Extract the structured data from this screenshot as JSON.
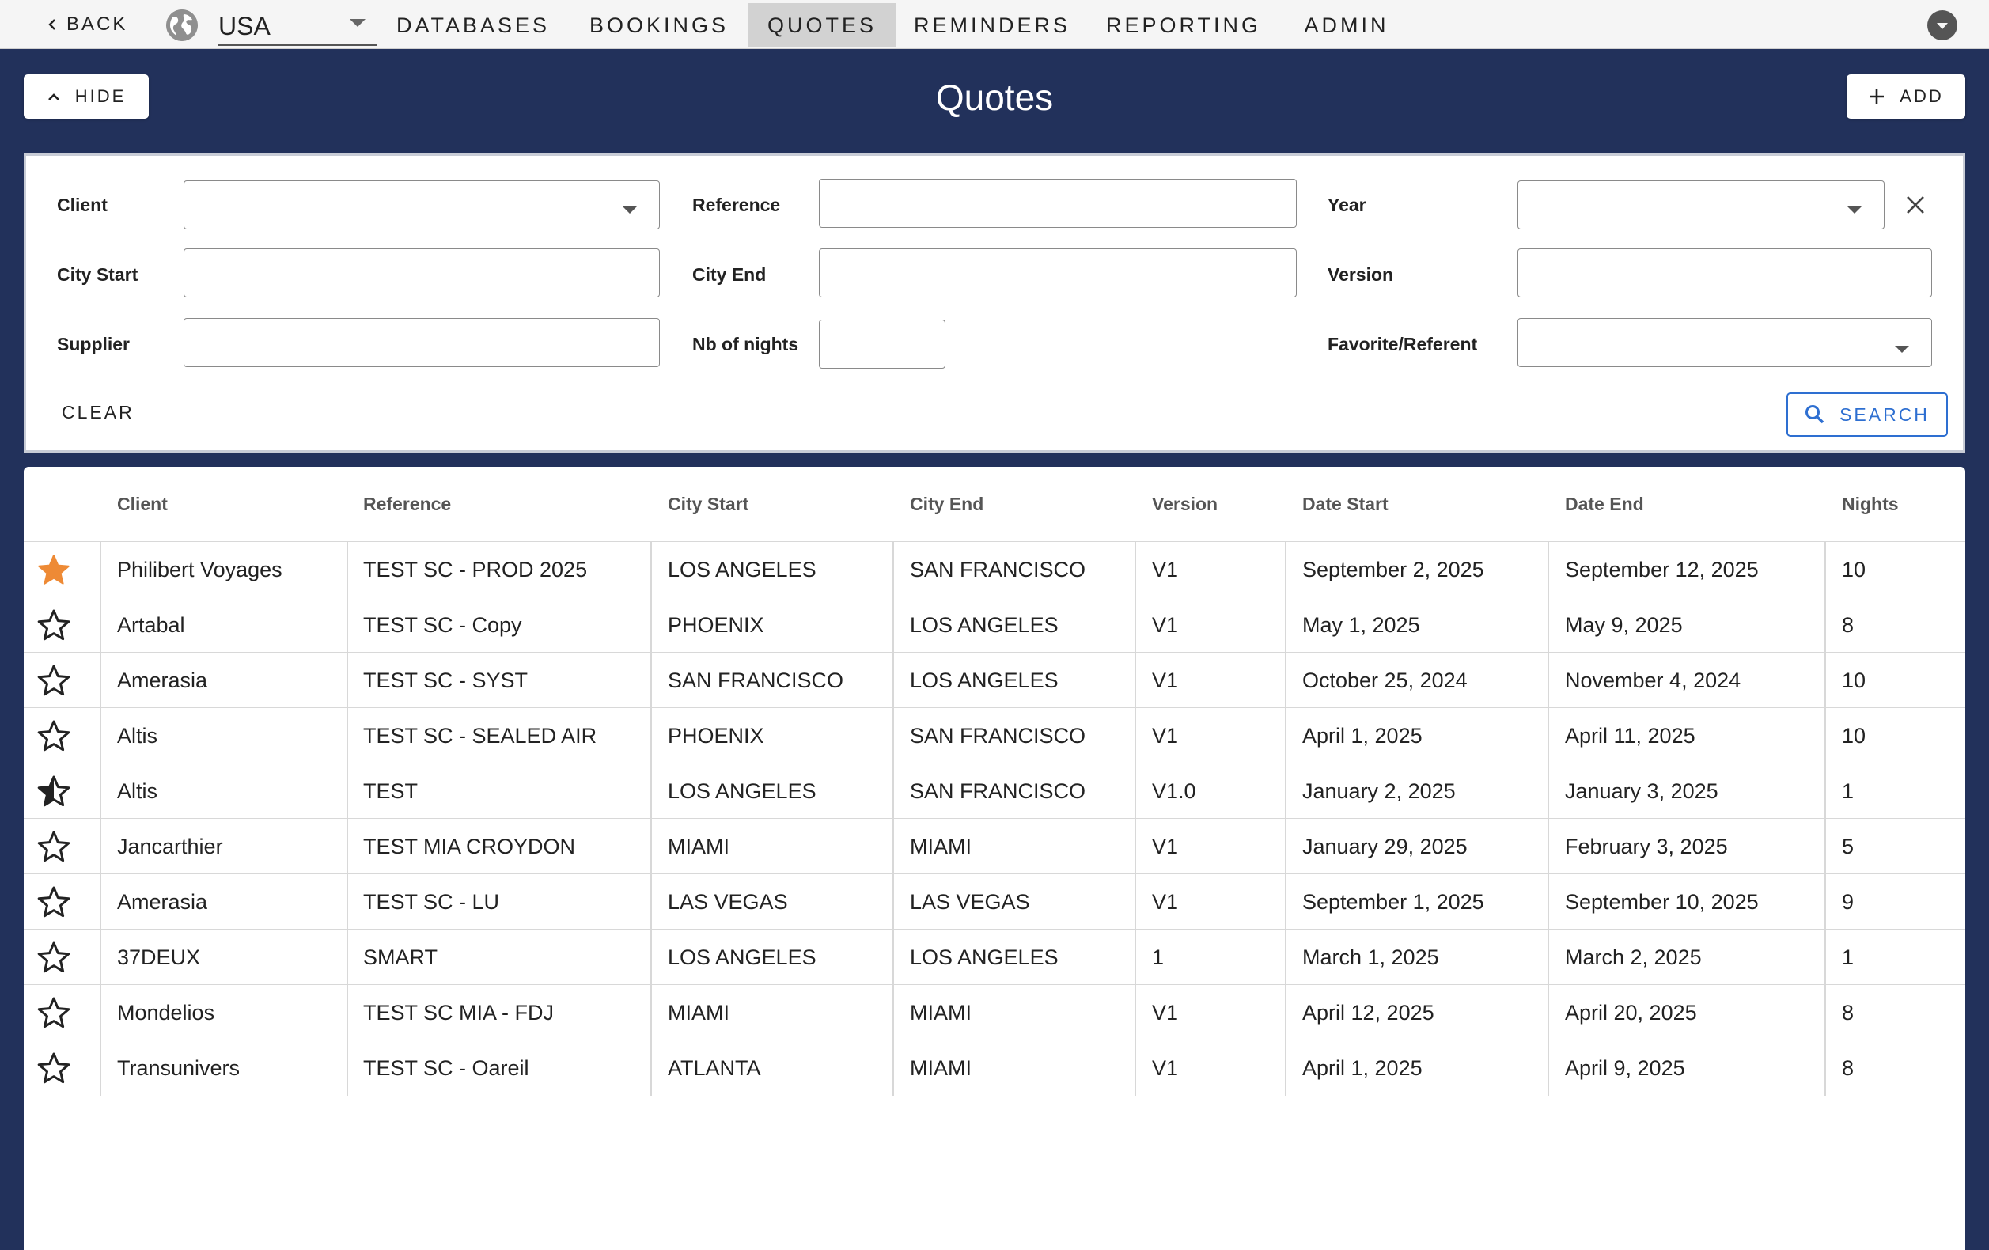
{
  "topbar": {
    "back_label": "BACK",
    "country": "USA",
    "tabs": [
      {
        "label": "DATABASES"
      },
      {
        "label": "BOOKINGS"
      },
      {
        "label": "QUOTES"
      },
      {
        "label": "REMINDERS"
      },
      {
        "label": "REPORTING"
      },
      {
        "label": "ADMIN"
      }
    ],
    "active_tab": "QUOTES"
  },
  "header": {
    "hide_label": "HIDE",
    "title": "Quotes",
    "add_label": "ADD"
  },
  "filters": {
    "client_label": "Client",
    "reference_label": "Reference",
    "year_label": "Year",
    "city_start_label": "City Start",
    "city_end_label": "City End",
    "version_label": "Version",
    "supplier_label": "Supplier",
    "nights_label": "Nb of nights",
    "favorite_label": "Favorite/Referent",
    "clear_label": "CLEAR",
    "search_label": "SEARCH"
  },
  "table": {
    "headers": [
      "Client",
      "Reference",
      "City Start",
      "City End",
      "Version",
      "Date Start",
      "Date End",
      "Nights"
    ],
    "rows": [
      {
        "star": "filled-orange",
        "client": "Philibert Voyages",
        "reference": "TEST SC - PROD 2025",
        "city_start": "LOS ANGELES",
        "city_end": "SAN FRANCISCO",
        "version": "V1",
        "date_start": "September 2, 2025",
        "date_end": "September 12, 2025",
        "nights": "10"
      },
      {
        "star": "outline",
        "client": "Artabal",
        "reference": "TEST SC - Copy",
        "city_start": "PHOENIX",
        "city_end": "LOS ANGELES",
        "version": "V1",
        "date_start": "May 1, 2025",
        "date_end": "May 9, 2025",
        "nights": "8"
      },
      {
        "star": "outline",
        "client": "Amerasia",
        "reference": "TEST SC - SYST",
        "city_start": "SAN FRANCISCO",
        "city_end": "LOS ANGELES",
        "version": "V1",
        "date_start": "October 25, 2024",
        "date_end": "November 4, 2024",
        "nights": "10"
      },
      {
        "star": "outline",
        "client": "Altis",
        "reference": "TEST SC - SEALED AIR",
        "city_start": "PHOENIX",
        "city_end": "SAN FRANCISCO",
        "version": "V1",
        "date_start": "April 1, 2025",
        "date_end": "April 11, 2025",
        "nights": "10"
      },
      {
        "star": "half",
        "client": "Altis",
        "reference": "TEST",
        "city_start": "LOS ANGELES",
        "city_end": "SAN FRANCISCO",
        "version": "V1.0",
        "date_start": "January 2, 2025",
        "date_end": "January 3, 2025",
        "nights": "1"
      },
      {
        "star": "outline",
        "client": "Jancarthier",
        "reference": "TEST MIA CROYDON",
        "city_start": "MIAMI",
        "city_end": "MIAMI",
        "version": "V1",
        "date_start": "January 29, 2025",
        "date_end": "February 3, 2025",
        "nights": "5"
      },
      {
        "star": "outline",
        "client": "Amerasia",
        "reference": "TEST SC - LU",
        "city_start": "LAS VEGAS",
        "city_end": "LAS VEGAS",
        "version": "V1",
        "date_start": "September 1, 2025",
        "date_end": "September 10, 2025",
        "nights": "9"
      },
      {
        "star": "outline",
        "client": "37DEUX",
        "reference": "SMART",
        "city_start": "LOS ANGELES",
        "city_end": "LOS ANGELES",
        "version": "1",
        "date_start": "March 1, 2025",
        "date_end": "March 2, 2025",
        "nights": "1"
      },
      {
        "star": "outline",
        "client": "Mondelios",
        "reference": "TEST SC MIA - FDJ",
        "city_start": "MIAMI",
        "city_end": "MIAMI",
        "version": "V1",
        "date_start": "April 12, 2025",
        "date_end": "April 20, 2025",
        "nights": "8"
      },
      {
        "star": "outline",
        "client": "Transunivers",
        "reference": "TEST SC - Oareil",
        "city_start": "ATLANTA",
        "city_end": "MIAMI",
        "version": "V1",
        "date_start": "April 1, 2025",
        "date_end": "April 9, 2025",
        "nights": "8"
      }
    ]
  },
  "colors": {
    "background": "#22315b",
    "accent_blue": "#2e6fd1",
    "favorite_orange": "#ee8a35",
    "active_tab": "#d2d2d2"
  },
  "icons": [
    "chevron-left-icon",
    "globe-icon",
    "caret-down-icon",
    "user-menu-icon",
    "chevron-up-icon",
    "plus-icon",
    "close-icon",
    "search-icon",
    "star-icon"
  ]
}
